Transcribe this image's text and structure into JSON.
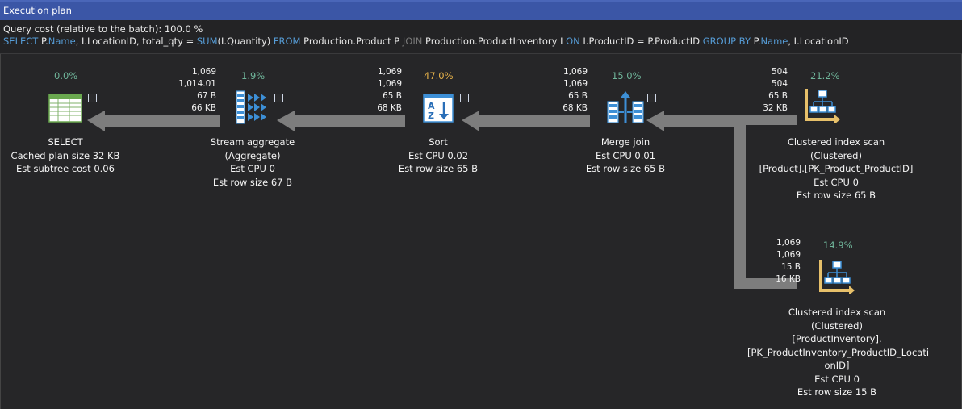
{
  "window": {
    "title": "Execution plan"
  },
  "query": {
    "cost_label": "Query cost (relative to the batch):  100.0 %",
    "tokens": [
      {
        "t": "SELECT",
        "k": "kw"
      },
      {
        "t": " P.",
        "k": ""
      },
      {
        "t": "Name",
        "k": "kw"
      },
      {
        "t": ", I.LocationID, total_qty = ",
        "k": ""
      },
      {
        "t": "SUM",
        "k": "kw"
      },
      {
        "t": "(I.Quantity) ",
        "k": ""
      },
      {
        "t": "FROM",
        "k": "kw"
      },
      {
        "t": " Production.Product P ",
        "k": ""
      },
      {
        "t": "JOIN",
        "k": "kw2"
      },
      {
        "t": " Production.ProductInventory I ",
        "k": ""
      },
      {
        "t": "ON",
        "k": "kw"
      },
      {
        "t": " I.ProductID = P.ProductID ",
        "k": ""
      },
      {
        "t": "GROUP BY",
        "k": "kw"
      },
      {
        "t": " P.",
        "k": ""
      },
      {
        "t": "Name",
        "k": "kw"
      },
      {
        "t": ", I.LocationID",
        "k": ""
      }
    ]
  },
  "colors": {
    "pct_normal": "#6fb59a",
    "pct_high": "#e8b34a",
    "arrow": "#7d7d7d",
    "icon_blue": "#3d8fd6",
    "icon_gold": "#e7c06a"
  },
  "nodes": {
    "select": {
      "pct": "0.0%",
      "stats": [],
      "label": [
        "SELECT",
        "Cached plan size  32 KB",
        "Est subtree cost  0.06"
      ],
      "icon": "results-grid-icon"
    },
    "stream_aggregate": {
      "pct": "1.9%",
      "stats": [
        "1,069",
        "1,014.01",
        "67 B",
        "66 KB"
      ],
      "label": [
        "Stream aggregate",
        "(Aggregate)",
        "Est CPU  0",
        "Est row size  67 B"
      ],
      "icon": "stream-aggregate-icon"
    },
    "sort": {
      "pct": "47.0%",
      "stats": [
        "1,069",
        "1,069",
        "65 B",
        "68 KB"
      ],
      "label": [
        "Sort",
        "Est CPU  0.02",
        "Est row size  65 B"
      ],
      "icon": "sort-icon"
    },
    "merge_join": {
      "pct": "15.0%",
      "stats": [
        "1,069",
        "1,069",
        "65 B",
        "68 KB"
      ],
      "label": [
        "Merge join",
        "Est CPU  0.01",
        "Est row size  65 B"
      ],
      "icon": "merge-join-icon"
    },
    "scan_product": {
      "pct": "21.2%",
      "stats": [
        "504",
        "504",
        "65 B",
        "32 KB"
      ],
      "label": [
        "Clustered index scan",
        "(Clustered)",
        "[Product].[PK_Product_ProductID]",
        "Est CPU  0",
        "Est row size  65 B"
      ],
      "icon": "clustered-index-scan-icon"
    },
    "scan_inventory": {
      "pct": "14.9%",
      "stats": [
        "1,069",
        "1,069",
        "15 B",
        "16 KB"
      ],
      "label": [
        "Clustered index scan",
        "(Clustered)",
        "[ProductInventory].",
        "[PK_ProductInventory_ProductID_Locati",
        "onID]",
        "Est CPU  0",
        "Est row size  15 B"
      ],
      "icon": "clustered-index-scan-icon"
    }
  }
}
